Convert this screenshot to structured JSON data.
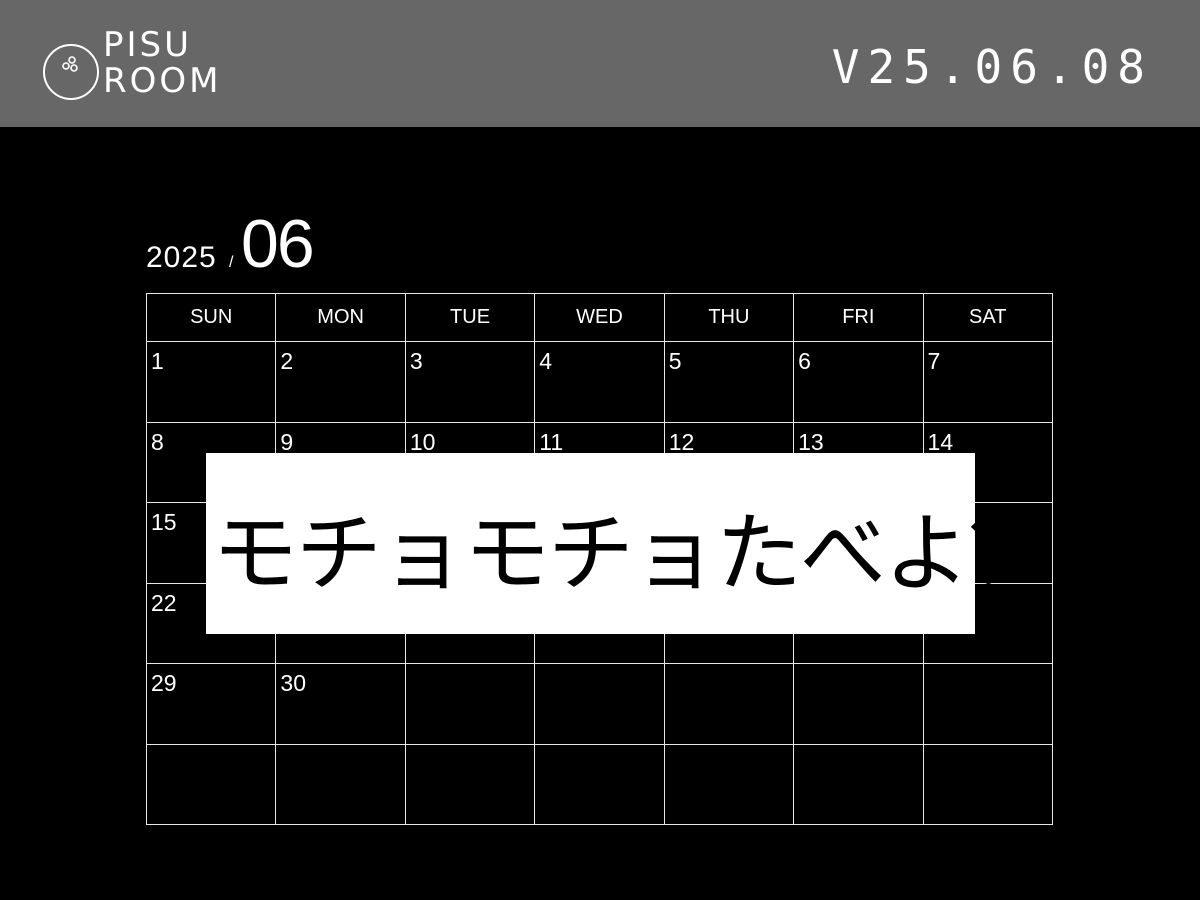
{
  "header": {
    "logo": {
      "line1": "PISU",
      "line2": "ROOM",
      "mark_icon": "bowling-ball-icon"
    },
    "version": "V25.06.08",
    "background": "#676767"
  },
  "calendar": {
    "year": "2025",
    "separator": "/",
    "month": "06",
    "weekdays": [
      "SUN",
      "MON",
      "TUE",
      "WED",
      "THU",
      "FRI",
      "SAT"
    ],
    "weeks": [
      [
        "1",
        "2",
        "3",
        "4",
        "5",
        "6",
        "7"
      ],
      [
        "8",
        "9",
        "10",
        "11",
        "12",
        "13",
        "14"
      ],
      [
        "15",
        "",
        "",
        "",
        "",
        "",
        ""
      ],
      [
        "22",
        "",
        "",
        "",
        "",
        "",
        ""
      ],
      [
        "29",
        "30",
        "",
        "",
        "",
        "",
        ""
      ],
      [
        "",
        "",
        "",
        "",
        "",
        "",
        ""
      ]
    ]
  },
  "overlay": {
    "text": "モチョモチョたべよ？"
  }
}
